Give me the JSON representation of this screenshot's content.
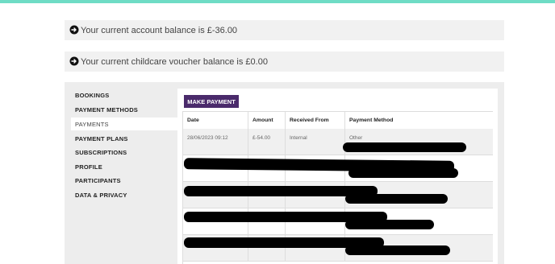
{
  "notices": {
    "account_balance": "Your current account balance is £-36.00",
    "voucher_balance": "Your current childcare voucher balance is £0.00"
  },
  "sidebar": {
    "items": [
      {
        "label": "BOOKINGS"
      },
      {
        "label": "PAYMENT METHODS"
      },
      {
        "label": "PAYMENTS"
      },
      {
        "label": "PAYMENT PLANS"
      },
      {
        "label": "SUBSCRIPTIONS"
      },
      {
        "label": "PROFILE"
      },
      {
        "label": "PARTICIPANTS"
      },
      {
        "label": "DATA & PRIVACY"
      }
    ],
    "active": "PAYMENTS"
  },
  "content": {
    "make_payment_label": "MAKE PAYMENT"
  },
  "table": {
    "headers": [
      "Date",
      "Amount",
      "Received From",
      "Payment Method"
    ],
    "rows": [
      {
        "date": "28/06/2023 09:12",
        "amount": "£-54.00",
        "received_from": "Internal",
        "payment_method": "Other"
      }
    ]
  },
  "colors": {
    "accent_bar": "#6fdcc5",
    "button": "#4a2a6b"
  },
  "icons": {
    "notice_icon": "arrow-circle-right-icon"
  }
}
